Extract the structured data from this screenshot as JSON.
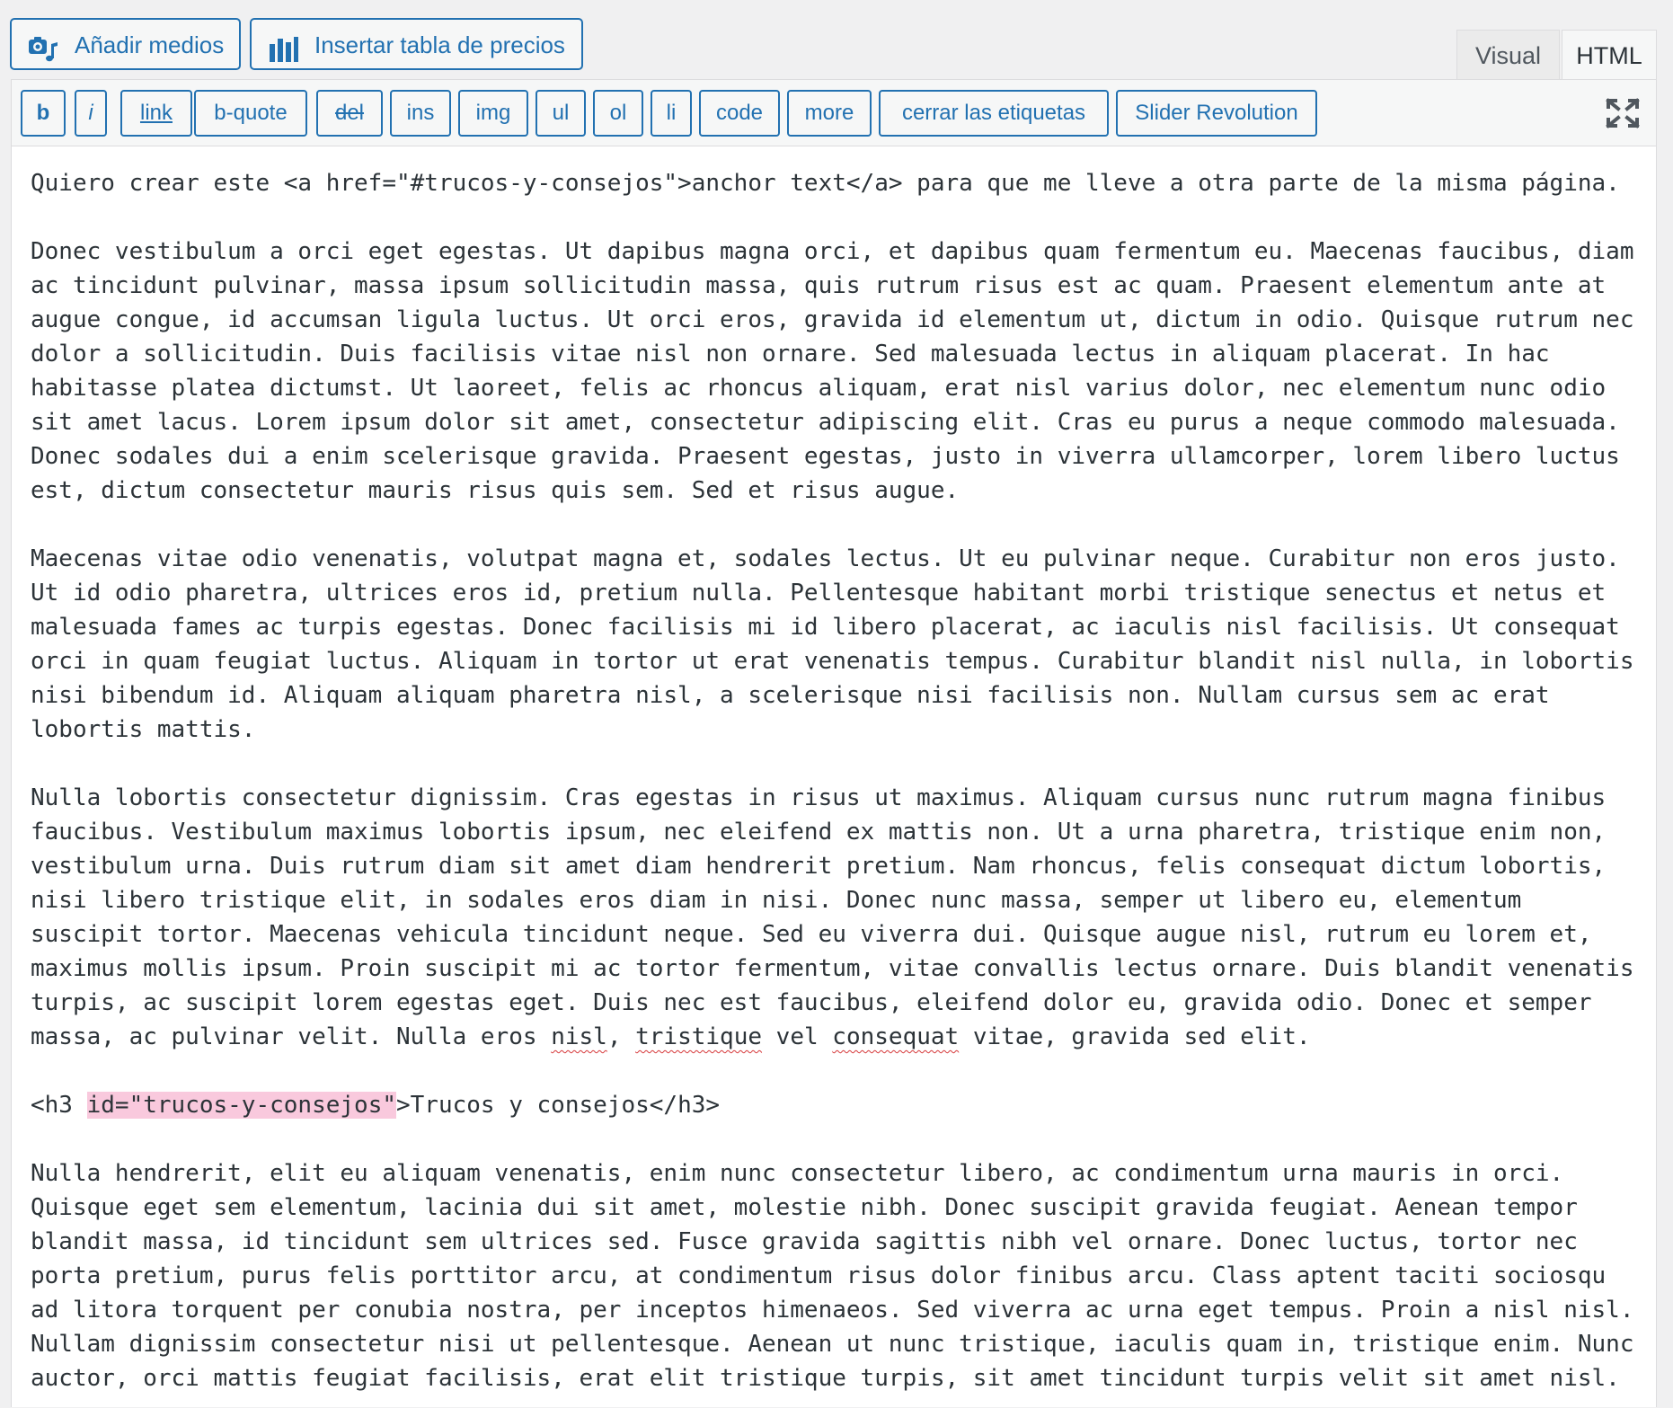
{
  "media_buttons": {
    "add_media": "Añadir medios",
    "insert_pricing_table": "Insertar tabla de precios"
  },
  "tabs": {
    "visual": "Visual",
    "html": "HTML",
    "active": "HTML"
  },
  "quicktags": [
    {
      "id": "b",
      "label": "b"
    },
    {
      "id": "i",
      "label": "i"
    },
    {
      "id": "link",
      "label": "link"
    },
    {
      "id": "b-quote",
      "label": "b-quote"
    },
    {
      "id": "del",
      "label": "del"
    },
    {
      "id": "ins",
      "label": "ins"
    },
    {
      "id": "img",
      "label": "img"
    },
    {
      "id": "ul",
      "label": "ul"
    },
    {
      "id": "ol",
      "label": "ol"
    },
    {
      "id": "li",
      "label": "li"
    },
    {
      "id": "code",
      "label": "code"
    },
    {
      "id": "more",
      "label": "more"
    },
    {
      "id": "close-tags",
      "label": "cerrar las etiquetas"
    },
    {
      "id": "slider-revolution",
      "label": "Slider Revolution"
    }
  ],
  "content": {
    "p1": "Quiero crear este <a href=\"#trucos-y-consejos\">anchor text</a> para que me lleve a otra parte de la misma página.",
    "p2": "Donec vestibulum a orci eget egestas. Ut dapibus magna orci, et dapibus quam fermentum eu. Maecenas faucibus, diam ac tincidunt pulvinar, massa ipsum sollicitudin massa, quis rutrum risus est ac quam. Praesent elementum ante at augue congue, id accumsan ligula luctus. Ut orci eros, gravida id elementum ut, dictum in odio. Quisque rutrum nec dolor a sollicitudin. Duis facilisis vitae nisl non ornare. Sed malesuada lectus in aliquam placerat. In hac habitasse platea dictumst. Ut laoreet, felis ac rhoncus aliquam, erat nisl varius dolor, nec elementum nunc odio sit amet lacus. Lorem ipsum dolor sit amet, consectetur adipiscing elit. Cras eu purus a neque commodo malesuada. Donec sodales dui a enim scelerisque gravida. Praesent egestas, justo in viverra ullamcorper, lorem libero luctus est, dictum consectetur mauris risus quis sem. Sed et risus augue.",
    "p3": "Maecenas vitae odio venenatis, volutpat magna et, sodales lectus. Ut eu pulvinar neque. Curabitur non eros justo. Ut id odio pharetra, ultrices eros id, pretium nulla. Pellentesque habitant morbi tristique senectus et netus et malesuada fames ac turpis egestas. Donec facilisis mi id libero placerat, ac iaculis nisl facilisis. Ut consequat orci in quam feugiat luctus. Aliquam in tortor ut erat venenatis tempus. Curabitur blandit nisl nulla, in lobortis nisi bibendum id. Aliquam aliquam pharetra nisl, a scelerisque nisi facilisis non. Nullam cursus sem ac erat lobortis mattis.",
    "p4_main": "Nulla lobortis consectetur dignissim. Cras egestas in risus ut maximus. Aliquam cursus nunc rutrum magna finibus faucibus. Vestibulum maximus lobortis ipsum, nec eleifend ex mattis non. Ut a urna pharetra, tristique enim non, vestibulum urna. Duis rutrum diam sit amet diam hendrerit pretium. Nam rhoncus, felis consequat dictum lobortis, nisi libero tristique elit, in sodales eros diam in nisi. Donec nunc massa, semper ut libero eu, elementum suscipit tortor. Maecenas vehicula tincidunt neque. Sed eu viverra dui. Quisque augue nisl, rutrum eu lorem et, maximus mollis ipsum. Proin suscipit mi ac tortor fermentum, vitae convallis lectus ornare. Duis blandit venenatis turpis, ac suscipit lorem egestas eget. Duis nec est faucibus, eleifend dolor eu, gravida odio. Donec et semper massa, ac pulvinar velit. Nulla eros ",
    "p4_w1": "nisl",
    "p4_s1": ", ",
    "p4_w2": "tristique",
    "p4_s2": " vel ",
    "p4_w3": "consequat",
    "p4_end": " vitae, gravida sed elit.",
    "h3_open": "<h3 ",
    "h3_id": "id=\"trucos-y-consejos\"",
    "h3_rest": ">Trucos y consejos</h3>",
    "p5": "Nulla hendrerit, elit eu aliquam venenatis, enim nunc consectetur libero, ac condimentum urna mauris in orci. Quisque eget sem elementum, lacinia dui sit amet, molestie nibh. Donec suscipit gravida feugiat. Aenean tempor blandit massa, id tincidunt sem ultrices sed. Fusce gravida sagittis nibh vel ornare. Donec luctus, tortor nec porta pretium, purus felis porttitor arcu, at condimentum risus dolor finibus arcu. Class aptent taciti sociosqu ad litora torquent per conubia nostra, per inceptos himenaeos. Sed viverra ac urna eget tempus. Proin a nisl nisl. Nullam dignissim consectetur nisi ut pellentesque. Aenean ut nunc tristique, iaculis quam in, tristique enim. Nunc auctor, orci mattis feugiat facilisis, erat elit tristique turpis, sit amet tincidunt turpis velit sit amet nisl."
  },
  "colors": {
    "accent": "#2271b1",
    "highlight": "#f9c9dd",
    "spellcheck": "#d63638"
  },
  "icons": {
    "add_media": "media-camera-music-icon",
    "insert_pricing_table": "bar-chart-icon",
    "fullscreen": "fullscreen-expand-icon"
  }
}
